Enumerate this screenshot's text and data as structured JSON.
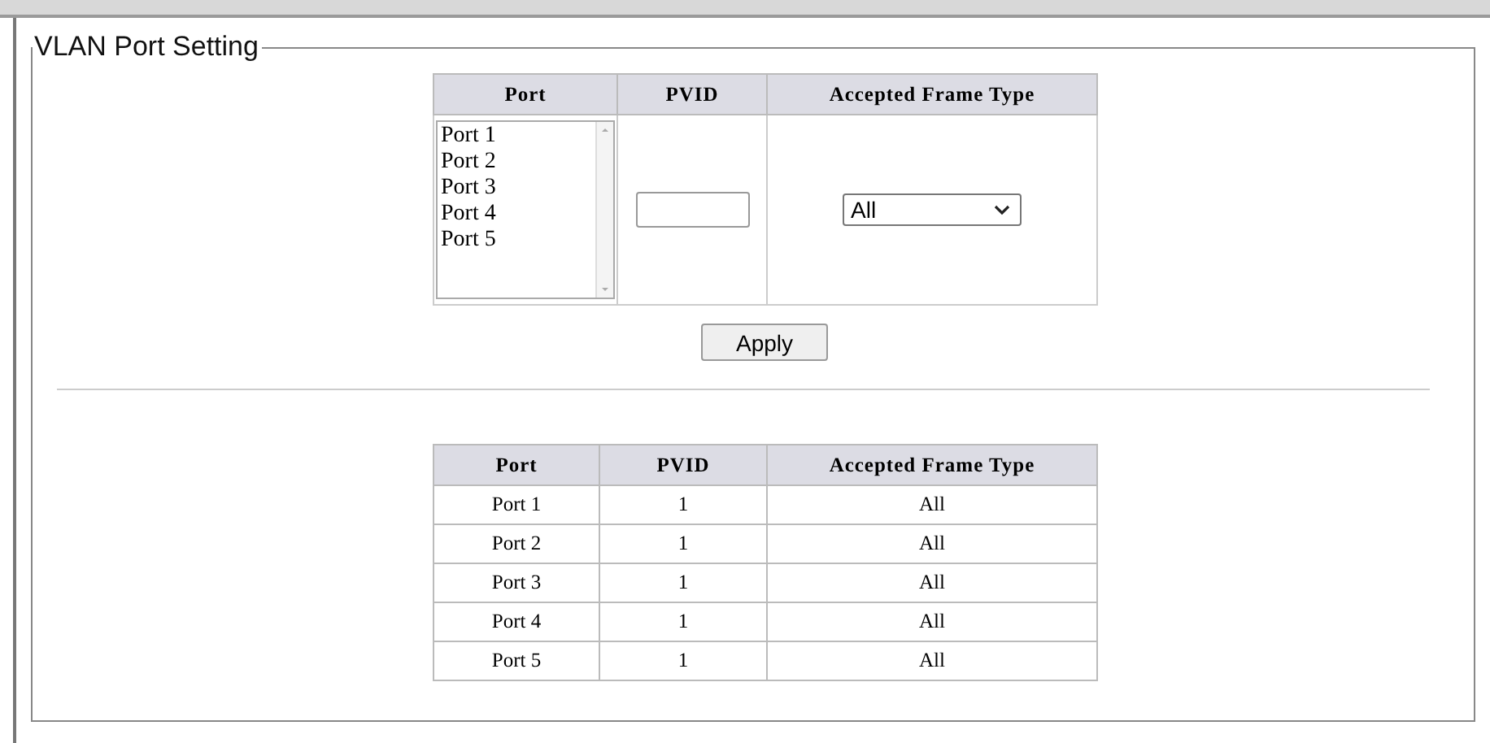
{
  "fieldset": {
    "legend": "VLAN Port Setting"
  },
  "form": {
    "columns": [
      "Port",
      "PVID",
      "Accepted Frame Type"
    ],
    "ports": [
      {
        "label": "Port 1",
        "selected": false
      },
      {
        "label": "Port 2",
        "selected": false
      },
      {
        "label": "Port 3",
        "selected": false
      },
      {
        "label": "Port 4",
        "selected": false
      },
      {
        "label": "Port 5",
        "selected": false
      }
    ],
    "frame_type": "All",
    "apply": "Apply"
  },
  "table": {
    "columns": [
      "Port",
      "PVID",
      "Accepted Frame Type"
    ],
    "rows": [
      [
        "Port 1",
        "1",
        "All"
      ],
      [
        "Port 2",
        "1",
        "All"
      ],
      [
        "Port 3",
        "1",
        "All"
      ],
      [
        "Port 4",
        "1",
        "All"
      ],
      [
        "Port 5",
        "1",
        "All"
      ]
    ]
  }
}
